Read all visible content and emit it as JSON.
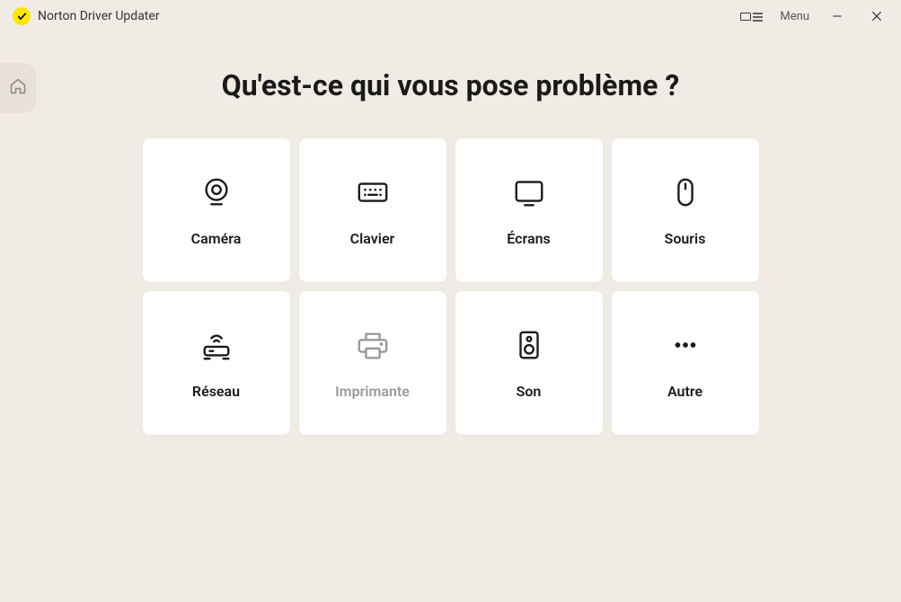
{
  "titlebar": {
    "app_name": "Norton Driver Updater",
    "menu_label": "Menu"
  },
  "main": {
    "heading": "Qu'est-ce qui vous pose problème ?",
    "categories": [
      {
        "id": "camera",
        "label": "Caméra",
        "disabled": false
      },
      {
        "id": "keyboard",
        "label": "Clavier",
        "disabled": false
      },
      {
        "id": "screens",
        "label": "Écrans",
        "disabled": false
      },
      {
        "id": "mouse",
        "label": "Souris",
        "disabled": false
      },
      {
        "id": "network",
        "label": "Réseau",
        "disabled": false
      },
      {
        "id": "printer",
        "label": "Imprimante",
        "disabled": true
      },
      {
        "id": "sound",
        "label": "Son",
        "disabled": false
      },
      {
        "id": "other",
        "label": "Autre",
        "disabled": false
      }
    ]
  }
}
